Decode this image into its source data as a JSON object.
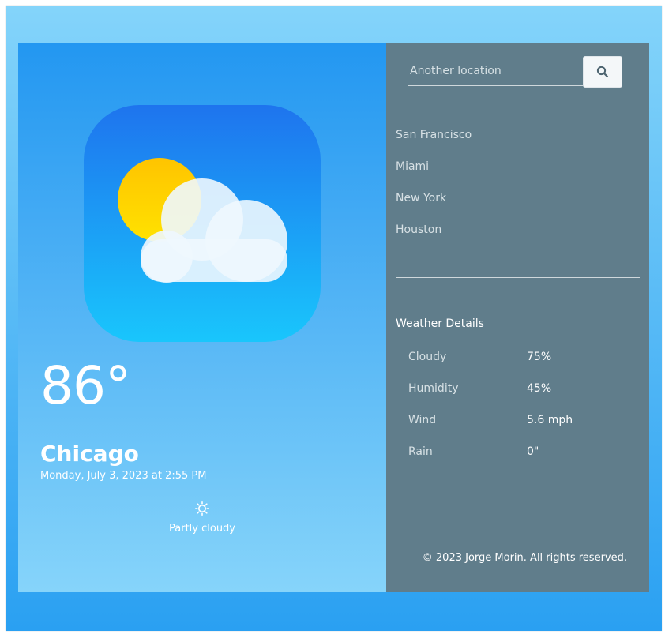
{
  "current": {
    "temperature": "86°",
    "city": "Chicago",
    "datetime": "Monday, July 3, 2023 at 2:55 PM",
    "condition": "Partly cloudy",
    "condition_icon": "sun-icon",
    "art_icon": "partly-cloudy-icon"
  },
  "search": {
    "placeholder": "Another location",
    "button_icon": "search-icon"
  },
  "locations": [
    "San Francisco",
    "Miami",
    "New York",
    "Houston"
  ],
  "details": {
    "title": "Weather Details",
    "rows": [
      {
        "label": "Cloudy",
        "value": "75%"
      },
      {
        "label": "Humidity",
        "value": "45%"
      },
      {
        "label": "Wind",
        "value": "5.6 mph"
      },
      {
        "label": "Rain",
        "value": "0\""
      }
    ]
  },
  "footer": {
    "text": "© 2023 Jorge Morin. All rights reserved."
  },
  "colors": {
    "sidebar": "#607d8b",
    "accent_blue": "#2397f1",
    "sun": "#ffcc00",
    "cloud": "#e6f4fd"
  }
}
